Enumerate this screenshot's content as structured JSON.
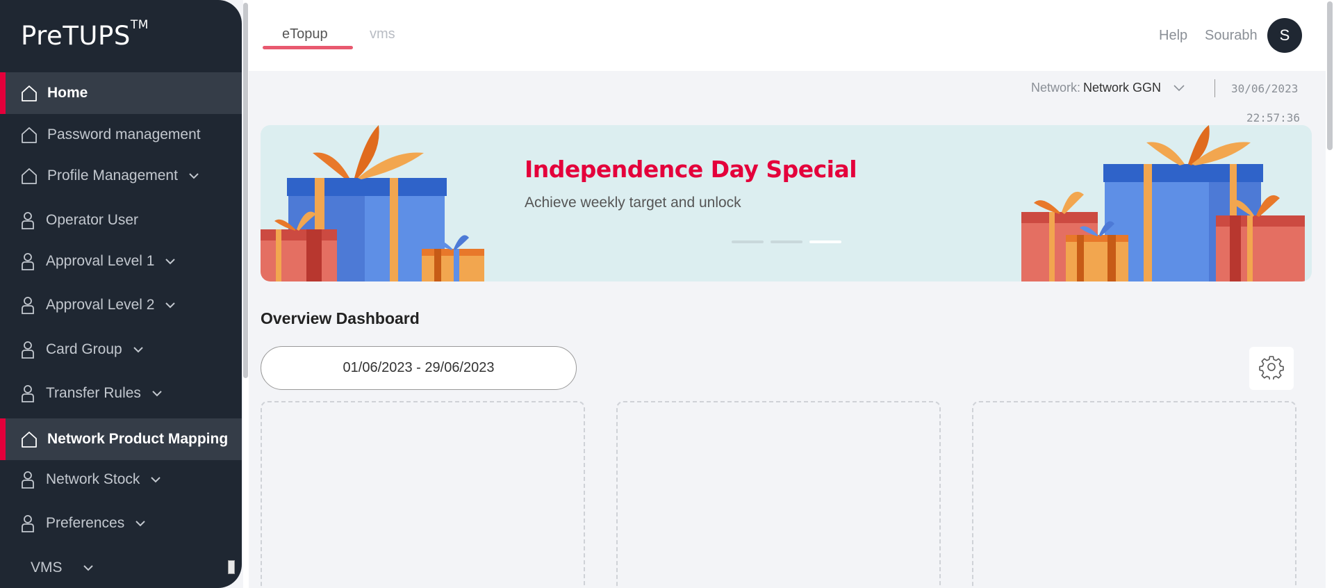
{
  "app": {
    "name": "PreTUPS",
    "trademark": "TM"
  },
  "sidebar": {
    "items": [
      {
        "label": "Home",
        "icon": "home-icon",
        "active": true,
        "expandable": false
      },
      {
        "label": "Password management",
        "icon": "home-icon",
        "active": false,
        "expandable": false
      },
      {
        "label": "Profile Management",
        "icon": "home-icon",
        "active": false,
        "expandable": true
      },
      {
        "label": "Operator User",
        "icon": "user-icon",
        "active": false,
        "expandable": false
      },
      {
        "label": "Approval Level 1",
        "icon": "user-icon",
        "active": false,
        "expandable": true
      },
      {
        "label": "Approval Level 2",
        "icon": "user-icon",
        "active": false,
        "expandable": true
      },
      {
        "label": "Card Group",
        "icon": "user-icon",
        "active": false,
        "expandable": true
      },
      {
        "label": "Transfer Rules",
        "icon": "user-icon",
        "active": false,
        "expandable": true
      },
      {
        "label": "Network Product Mapping",
        "icon": "home-icon",
        "active": true,
        "expandable": false
      },
      {
        "label": "Network Stock",
        "icon": "user-icon",
        "active": false,
        "expandable": true
      },
      {
        "label": "Preferences",
        "icon": "user-icon",
        "active": false,
        "expandable": true
      },
      {
        "label": "VMS",
        "icon": "",
        "active": false,
        "expandable": true
      }
    ]
  },
  "header": {
    "tabs": [
      {
        "label": "eTopup",
        "active": true
      },
      {
        "label": "vms",
        "active": false
      }
    ],
    "help_label": "Help",
    "username": "Sourabh",
    "avatar_initial": "S"
  },
  "network": {
    "label": "Network:",
    "value": "Network GGN"
  },
  "datetime": {
    "date": "30/06/2023",
    "time": "22:57:36"
  },
  "banner": {
    "title": "Independence Day Special",
    "subtitle": "Achieve weekly target and unlock",
    "slides": 3,
    "active_slide": 3
  },
  "overview": {
    "title": "Overview Dashboard",
    "date_range": "01/06/2023 - 29/06/2023"
  },
  "colors": {
    "accent": "#e4003b",
    "sidebar_bg": "#1f2732",
    "tab_underline": "#e8596f"
  }
}
